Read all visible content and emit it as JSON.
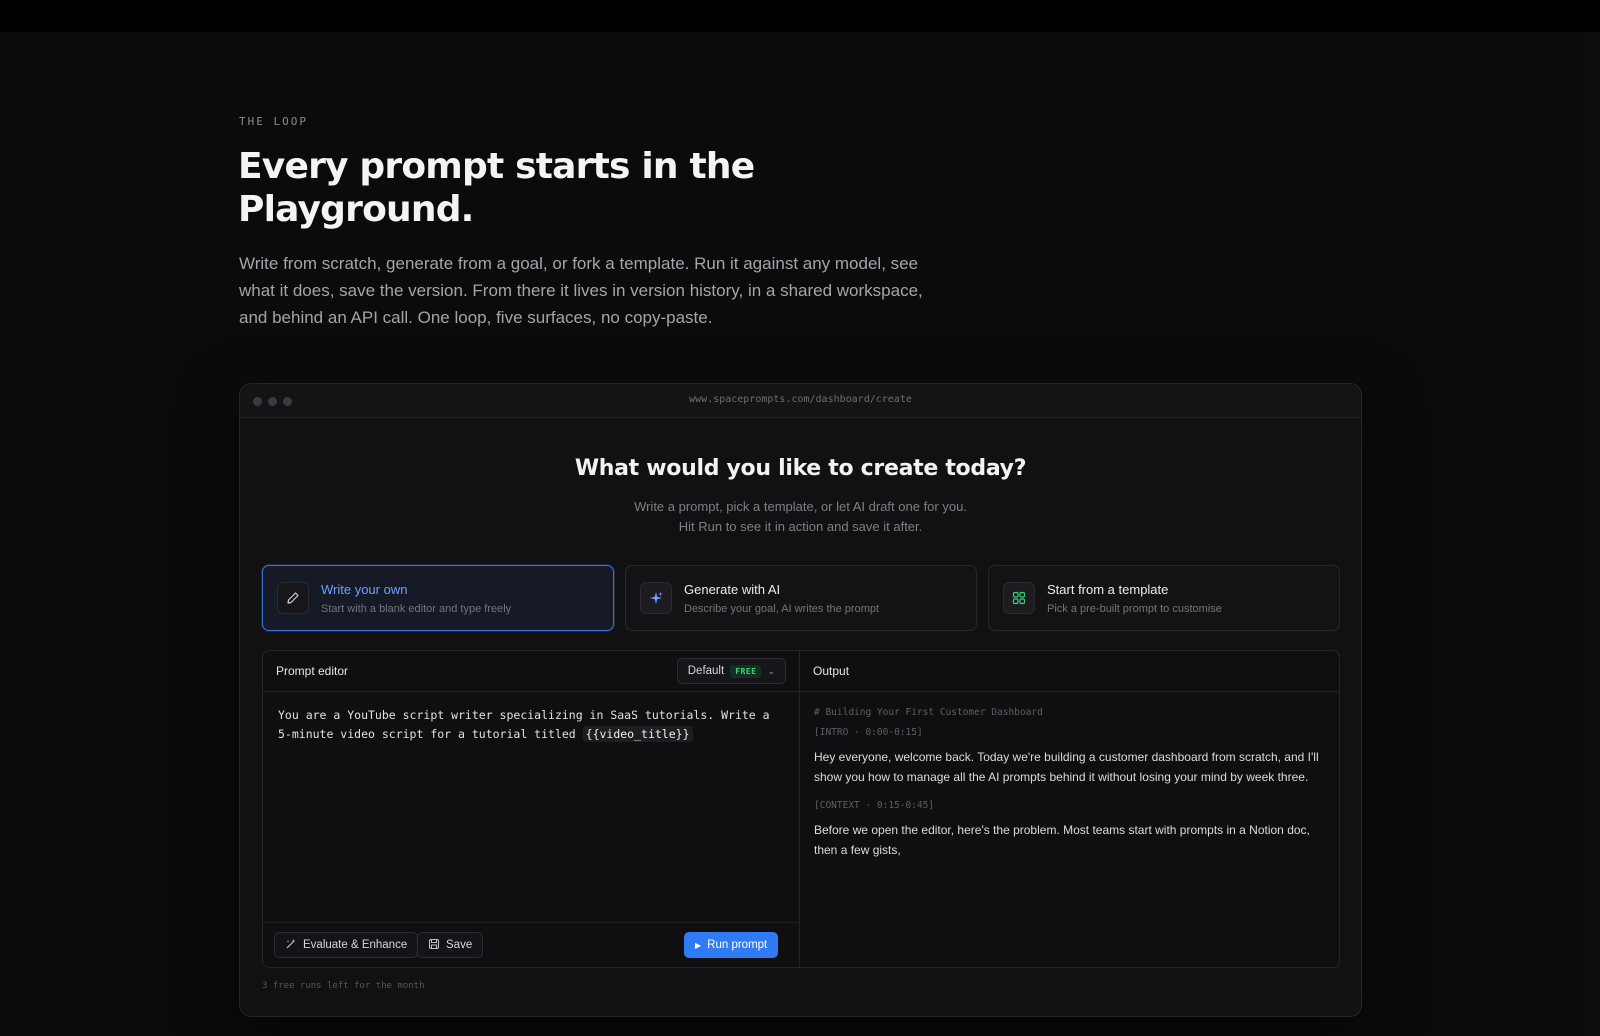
{
  "hero": {
    "eyebrow": "THE LOOP",
    "title": "Every prompt starts in the Playground.",
    "description": "Write from scratch, generate from a goal, or fork a template. Run it against any model, see what it does, save the version. From there it lives in version history, in a shared workspace, and behind an API call. One loop, five surfaces, no copy-paste."
  },
  "window": {
    "url": "www.spaceprompts.com/dashboard/create"
  },
  "create": {
    "title": "What would you like to create today?",
    "subtitle_line1": "Write a prompt, pick a template, or let AI draft one for you.",
    "subtitle_line2": "Hit Run to see it in action and save it after."
  },
  "modes": [
    {
      "title": "Write your own",
      "subtitle": "Start with a blank editor and type freely",
      "icon": "pencil-icon",
      "active": true
    },
    {
      "title": "Generate with AI",
      "subtitle": "Describe your goal, AI writes the prompt",
      "icon": "sparkle-icon",
      "active": false
    },
    {
      "title": "Start from a template",
      "subtitle": "Pick a pre-built prompt to customise",
      "icon": "grid-icon",
      "active": false
    }
  ],
  "editor": {
    "label": "Prompt editor",
    "model": "Default",
    "model_badge": "FREE",
    "prompt_text": "You are a YouTube script writer specializing in SaaS tutorials. Write a 5-minute video script for a tutorial titled ",
    "variable": "{{video_title}}",
    "evaluate_label": "Evaluate & Enhance",
    "save_label": "Save",
    "run_label": "Run prompt"
  },
  "output": {
    "label": "Output",
    "heading": "# Building Your First Customer Dashboard",
    "section1_tag": "[INTRO · 0:00-0:15]",
    "section1_text": "Hey everyone, welcome back. Today we're building a customer dashboard from scratch, and I'll show you how to manage all the AI prompts behind it without losing your mind by week three.",
    "section2_tag": "[CONTEXT · 0:15-0:45]",
    "section2_text": "Before we open the editor, here's the problem. Most teams start with prompts in a Notion doc, then a few gists,"
  },
  "footer": {
    "runs_left": "3 free runs left for the month"
  },
  "colors": {
    "accent": "#2f7bf5",
    "active_border": "#3d6fd6",
    "free_badge": "#3ecf7a"
  }
}
